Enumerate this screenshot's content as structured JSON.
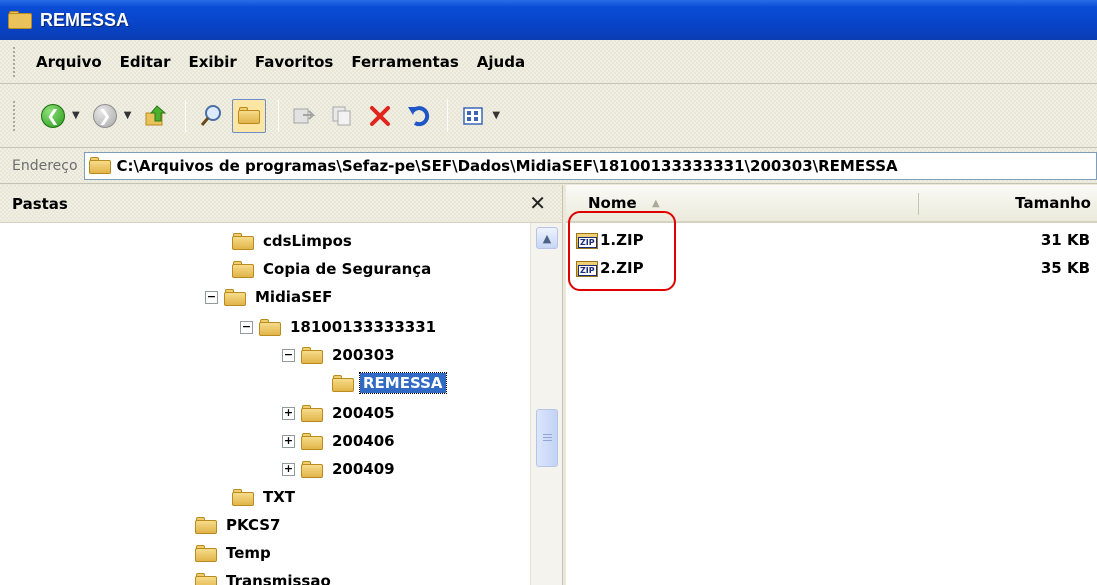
{
  "window": {
    "title": "REMESSA"
  },
  "menu": [
    "Arquivo",
    "Editar",
    "Exibir",
    "Favoritos",
    "Ferramentas",
    "Ajuda"
  ],
  "toolbar": {
    "icons": [
      "back-icon",
      "forward-icon",
      "up-folder-icon",
      "search-icon",
      "folders-icon",
      "move-to-icon",
      "copy-to-icon",
      "delete-icon",
      "undo-icon",
      "views-icon"
    ]
  },
  "address": {
    "label": "Endereço",
    "path": "C:\\Arquivos de programas\\Sefaz-pe\\SEF\\Dados\\MidiaSEF\\18100133333331\\200303\\REMESSA"
  },
  "folders_panel": {
    "title": "Pastas",
    "close": "✕",
    "tree": [
      {
        "label": "cdsLimpos",
        "expander": ""
      },
      {
        "label": "Copia de Segurança",
        "expander": ""
      },
      {
        "label": "MidiaSEF",
        "expander": "−"
      },
      {
        "label": "18100133333331",
        "expander": "−"
      },
      {
        "label": "200303",
        "expander": "−"
      },
      {
        "label": "REMESSA",
        "expander": "",
        "selected": true
      },
      {
        "label": "200405",
        "expander": "+"
      },
      {
        "label": "200406",
        "expander": "+"
      },
      {
        "label": "200409",
        "expander": "+"
      },
      {
        "label": "TXT",
        "expander": ""
      },
      {
        "label": "PKCS7",
        "expander": ""
      },
      {
        "label": "Temp",
        "expander": ""
      },
      {
        "label": "Transmissao",
        "expander": ""
      }
    ]
  },
  "file_list": {
    "columns": {
      "name": "Nome",
      "size": "Tamanho"
    },
    "files": [
      {
        "name": "1.ZIP",
        "size": "31 KB"
      },
      {
        "name": "2.ZIP",
        "size": "35 KB"
      }
    ]
  },
  "colors": {
    "titlebar": "#0a4cd6",
    "selection": "#316ac5",
    "highlight": "#e00000"
  }
}
